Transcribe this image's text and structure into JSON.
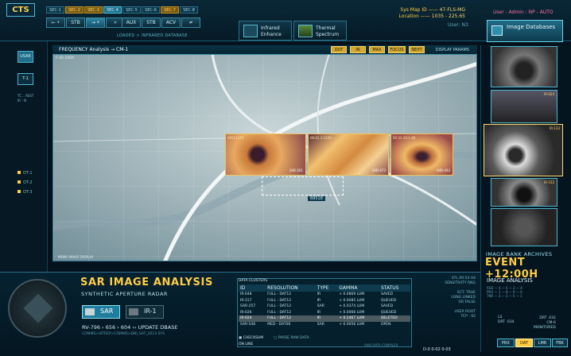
{
  "app": {
    "logo": "CTS"
  },
  "sectors": [
    "SEC-1",
    "SEC-2",
    "SEC-3",
    "SEC-4",
    "SEC-5",
    "SEC-6",
    "SEC-7",
    "SEC-8"
  ],
  "controls": [
    "STB",
    "AUX",
    "STB",
    "ACV"
  ],
  "loaded_text": "LOADED > INFRARED DATABASE",
  "modes": {
    "infrared": "Infrared Enhance",
    "thermal": "Thermal Spectrum"
  },
  "sysmap": {
    "l1": "Sys Map ID",
    "v1": "47-FLS-MG",
    "l2": "Location",
    "v2": "1035 - 225.65"
  },
  "user": {
    "top": "User - Admin : NP - AUTO",
    "line": "User: N3"
  },
  "image_databases": "Image Databases",
  "left": {
    "usar": "USAR",
    "t1": "T-1",
    "t1_sub": "TC... REST\nIR - N",
    "opts": [
      "OT-1",
      "OT-2",
      "OT-3"
    ]
  },
  "main": {
    "header": "FREQUENCY Analysis → CM-1",
    "sub": "F-42 100X",
    "ctrls": [
      "OUT",
      "IN",
      "MAX",
      "FOCUS",
      "NEXT"
    ],
    "display": "DISPLAY PARAMS",
    "sel_value": "69518",
    "minimap": "MEMO IMAGE DISPLAY",
    "thumbs": [
      {
        "cap": "00512310",
        "tag": "SAR-201"
      },
      {
        "cap": "06:01 2:1100",
        "tag": "SAR-473"
      },
      {
        "cap": "00:22 20:1 48",
        "tag": "SAR-443"
      }
    ]
  },
  "right": {
    "thumbs": [
      "IR-024",
      "IR-133",
      "IR-152"
    ],
    "archives": "IMAGE BANK ARCHIVES",
    "event": "EVENT +12:00H",
    "ia_title": "IMAGE ANALYSIS",
    "ia_rows": [
      "RSD — 4 — 6 — 2 — 4",
      "PRO — 1 — 8 — 9 — 0",
      "TNR — 3 — 3 — 5 — 1"
    ],
    "ls": "LS\nDRT .034",
    "drt": "DRT .032\nCM-6\nMONITORED",
    "btns": [
      "PRX",
      "DAT",
      "LMR",
      "FBK"
    ]
  },
  "bottom": {
    "title": "SAR IMAGE ANALYSIS",
    "subtitle": "SYNTHETIC APERTURE RADAR",
    "mode_sar": "SAR",
    "mode_ir": "IR-1",
    "rv_line": "RV-796  ›  656  ›  604  ››  UPDATE DBASE",
    "path": "COMMS>SITREP>COMMS>DNI_SAT_2613 SYS"
  },
  "clusters": {
    "header": "DATA CLUSTERS",
    "cols": [
      "ID",
      "RESOLUTION",
      "TYPE",
      "GAMMA",
      "STATUS"
    ],
    "rows": [
      [
        "IR-048",
        "FULL - DAT12",
        "IR",
        "+ 0.0869 LUM",
        "SAVED"
      ],
      [
        "IR-317",
        "FULL - DAT12",
        "IR",
        "+ 0.0085 LUM",
        "QUEUED"
      ],
      [
        "SAR-257",
        "FULL - DAT12",
        "SAR",
        "+ 0.0374 LUM",
        "SAVED"
      ],
      [
        "IR-026",
        "FULL - DAT12",
        "IR",
        "+ 0.0066 LUM",
        "QUEUED"
      ],
      [
        "IR-024",
        "FULL - DAT12",
        "IR",
        "+ 0.2467 LUM",
        "DELETED"
      ],
      [
        "SAR-546",
        "MED - DAT06",
        "SAR",
        "+ 0.0056 LUM",
        "OPEN"
      ]
    ],
    "selected_row": 4,
    "checksum": "CHECKSUM",
    "parse": "PARSE RAW DATA",
    "online": "ON LINE",
    "compiler": "RAW DATA COMPILER"
  },
  "stats": "STL.00:54 H4\nSENSITIVITY RNG\n\nSCT: TRUE\nLONG LINKED\nGR FALSE\n\nUSER ROOT\nTCP : 92",
  "clock": "D-0   0-02   0-03"
}
